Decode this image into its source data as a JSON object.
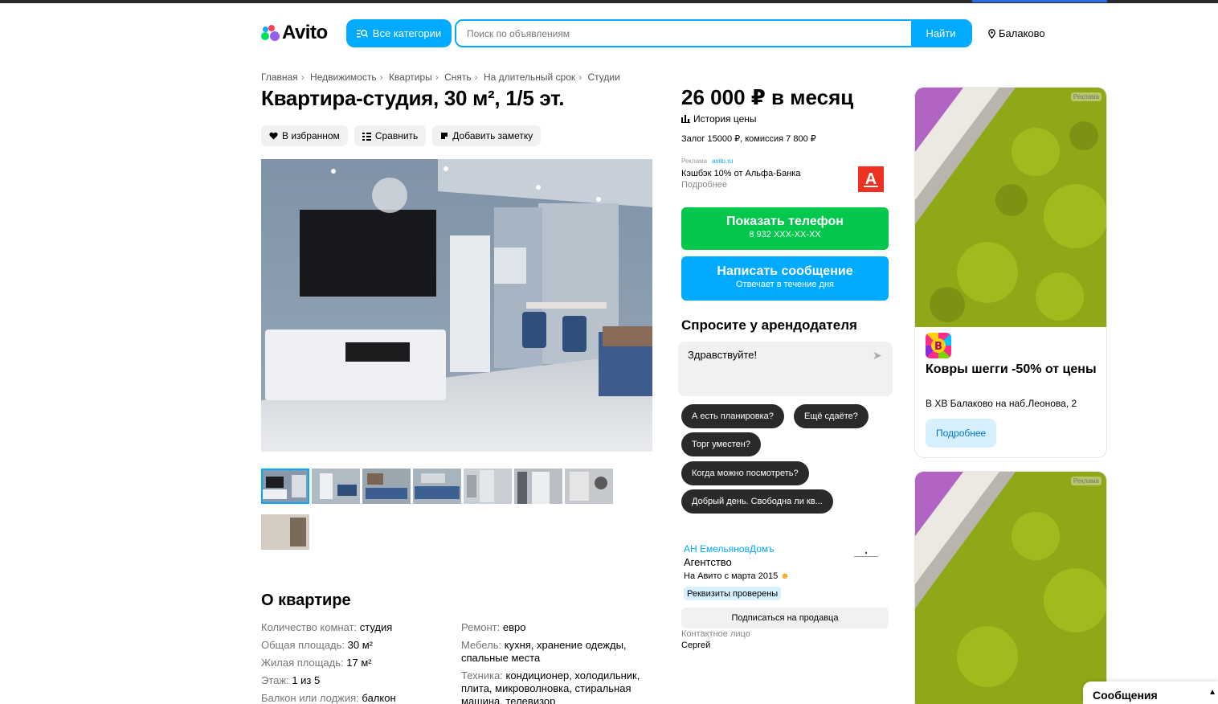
{
  "header": {
    "logo_text": "Avito",
    "categories_label": "Все категории",
    "search_placeholder": "Поиск по объявлениям",
    "search_button": "Найти",
    "location": "Балаково"
  },
  "breadcrumb": [
    "Главная",
    "Недвижимость",
    "Квартиры",
    "Снять",
    "На длительный срок",
    "Студии"
  ],
  "listing": {
    "title": "Квартира-студия, 30 м², 1/5 эт.",
    "actions": {
      "favorite": "В избранном",
      "compare": "Сравнить",
      "note": "Добавить заметку"
    },
    "thumbnail_count": 8
  },
  "about": {
    "title": "О квартире",
    "left": [
      {
        "key": "Количество комнат:",
        "value": "студия"
      },
      {
        "key": "Общая площадь:",
        "value": "30 м²"
      },
      {
        "key": "Жилая площадь:",
        "value": "17 м²"
      },
      {
        "key": "Этаж:",
        "value": "1 из 5"
      },
      {
        "key": "Балкон или лоджия:",
        "value": "балкон"
      }
    ],
    "right": [
      {
        "key": "Ремонт:",
        "value": "евро"
      },
      {
        "key": "Мебель:",
        "value": "кухня, хранение одежды, спальные места"
      },
      {
        "key": "Техника:",
        "value": "кондиционер, холодильник, плита, микроволновка, стиральная машина, телевизор"
      }
    ]
  },
  "price": {
    "value": "26 000 ₽ в месяц",
    "history_label": "История цены",
    "deposit": "Залог 15000 ₽, комиссия 7 800 ₽"
  },
  "small_ad": {
    "label": "Реклама",
    "domain": "avito.ru",
    "text": "Кэшбэк 10% от Альфа-Банка",
    "more": "Подробнее",
    "logo_letter": "А"
  },
  "buttons": {
    "phone_label": "Показать телефон",
    "phone_number": "8 932 XXX-XX-XX",
    "message_label": "Написать сообщение",
    "message_sub": "Отвечает в течение дня"
  },
  "ask": {
    "title": "Спросите у арендодателя",
    "input_value": "Здравствуйте!",
    "chips": [
      "А есть планировка?",
      "Ещё сдаёте?",
      "Торг уместен?",
      "Когда можно посмотреть?",
      "Добрый день. Свободна ли кв..."
    ]
  },
  "seller": {
    "name": "АН ЕмельяновДомъ",
    "type": "Агентство",
    "since": "На Авито с марта 2015",
    "verified": "Реквизиты проверены",
    "subscribe": "Подписаться на продавца",
    "contact_label": "Контактное лицо",
    "contact_name": "Сергей"
  },
  "ads": [
    {
      "label": "Реклама",
      "logo_letter": "B",
      "title": "Ковры шегги -50% от цены",
      "subtitle": "В ХВ Балаково на наб.Леонова, 2",
      "button": "Подробнее"
    },
    {
      "label": "Реклама"
    }
  ],
  "messages_panel": {
    "label": "Сообщения"
  },
  "colors": {
    "accent": "#00aaff",
    "phone_green": "#04c74d",
    "chip_dark": "#2a2a2a",
    "alfa_red": "#ef3124"
  }
}
